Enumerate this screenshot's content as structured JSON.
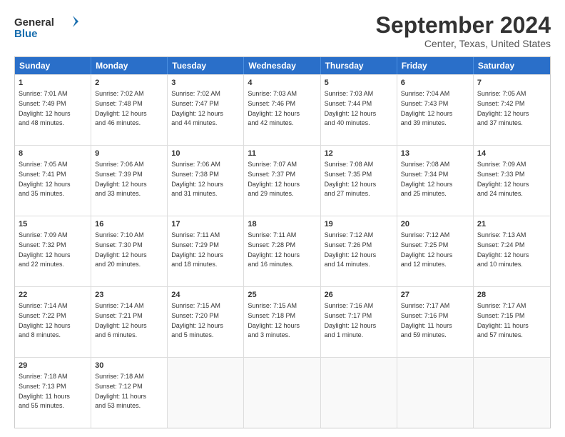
{
  "logo": {
    "line1": "General",
    "line2": "Blue"
  },
  "title": "September 2024",
  "subtitle": "Center, Texas, United States",
  "headers": [
    "Sunday",
    "Monday",
    "Tuesday",
    "Wednesday",
    "Thursday",
    "Friday",
    "Saturday"
  ],
  "rows": [
    [
      {
        "day": "",
        "empty": true
      },
      {
        "day": "",
        "empty": true
      },
      {
        "day": "",
        "empty": true
      },
      {
        "day": "",
        "empty": true
      },
      {
        "day": "",
        "empty": true
      },
      {
        "day": "",
        "empty": true
      },
      {
        "day": "",
        "empty": true
      }
    ],
    [
      {
        "day": "1",
        "text": "Sunrise: 7:01 AM\nSunset: 7:49 PM\nDaylight: 12 hours\nand 48 minutes."
      },
      {
        "day": "2",
        "text": "Sunrise: 7:02 AM\nSunset: 7:48 PM\nDaylight: 12 hours\nand 46 minutes."
      },
      {
        "day": "3",
        "text": "Sunrise: 7:02 AM\nSunset: 7:47 PM\nDaylight: 12 hours\nand 44 minutes."
      },
      {
        "day": "4",
        "text": "Sunrise: 7:03 AM\nSunset: 7:46 PM\nDaylight: 12 hours\nand 42 minutes."
      },
      {
        "day": "5",
        "text": "Sunrise: 7:03 AM\nSunset: 7:44 PM\nDaylight: 12 hours\nand 40 minutes."
      },
      {
        "day": "6",
        "text": "Sunrise: 7:04 AM\nSunset: 7:43 PM\nDaylight: 12 hours\nand 39 minutes."
      },
      {
        "day": "7",
        "text": "Sunrise: 7:05 AM\nSunset: 7:42 PM\nDaylight: 12 hours\nand 37 minutes."
      }
    ],
    [
      {
        "day": "8",
        "text": "Sunrise: 7:05 AM\nSunset: 7:41 PM\nDaylight: 12 hours\nand 35 minutes."
      },
      {
        "day": "9",
        "text": "Sunrise: 7:06 AM\nSunset: 7:39 PM\nDaylight: 12 hours\nand 33 minutes."
      },
      {
        "day": "10",
        "text": "Sunrise: 7:06 AM\nSunset: 7:38 PM\nDaylight: 12 hours\nand 31 minutes."
      },
      {
        "day": "11",
        "text": "Sunrise: 7:07 AM\nSunset: 7:37 PM\nDaylight: 12 hours\nand 29 minutes."
      },
      {
        "day": "12",
        "text": "Sunrise: 7:08 AM\nSunset: 7:35 PM\nDaylight: 12 hours\nand 27 minutes."
      },
      {
        "day": "13",
        "text": "Sunrise: 7:08 AM\nSunset: 7:34 PM\nDaylight: 12 hours\nand 25 minutes."
      },
      {
        "day": "14",
        "text": "Sunrise: 7:09 AM\nSunset: 7:33 PM\nDaylight: 12 hours\nand 24 minutes."
      }
    ],
    [
      {
        "day": "15",
        "text": "Sunrise: 7:09 AM\nSunset: 7:32 PM\nDaylight: 12 hours\nand 22 minutes."
      },
      {
        "day": "16",
        "text": "Sunrise: 7:10 AM\nSunset: 7:30 PM\nDaylight: 12 hours\nand 20 minutes."
      },
      {
        "day": "17",
        "text": "Sunrise: 7:11 AM\nSunset: 7:29 PM\nDaylight: 12 hours\nand 18 minutes."
      },
      {
        "day": "18",
        "text": "Sunrise: 7:11 AM\nSunset: 7:28 PM\nDaylight: 12 hours\nand 16 minutes."
      },
      {
        "day": "19",
        "text": "Sunrise: 7:12 AM\nSunset: 7:26 PM\nDaylight: 12 hours\nand 14 minutes."
      },
      {
        "day": "20",
        "text": "Sunrise: 7:12 AM\nSunset: 7:25 PM\nDaylight: 12 hours\nand 12 minutes."
      },
      {
        "day": "21",
        "text": "Sunrise: 7:13 AM\nSunset: 7:24 PM\nDaylight: 12 hours\nand 10 minutes."
      }
    ],
    [
      {
        "day": "22",
        "text": "Sunrise: 7:14 AM\nSunset: 7:22 PM\nDaylight: 12 hours\nand 8 minutes."
      },
      {
        "day": "23",
        "text": "Sunrise: 7:14 AM\nSunset: 7:21 PM\nDaylight: 12 hours\nand 6 minutes."
      },
      {
        "day": "24",
        "text": "Sunrise: 7:15 AM\nSunset: 7:20 PM\nDaylight: 12 hours\nand 5 minutes."
      },
      {
        "day": "25",
        "text": "Sunrise: 7:15 AM\nSunset: 7:18 PM\nDaylight: 12 hours\nand 3 minutes."
      },
      {
        "day": "26",
        "text": "Sunrise: 7:16 AM\nSunset: 7:17 PM\nDaylight: 12 hours\nand 1 minute."
      },
      {
        "day": "27",
        "text": "Sunrise: 7:17 AM\nSunset: 7:16 PM\nDaylight: 11 hours\nand 59 minutes."
      },
      {
        "day": "28",
        "text": "Sunrise: 7:17 AM\nSunset: 7:15 PM\nDaylight: 11 hours\nand 57 minutes."
      }
    ],
    [
      {
        "day": "29",
        "text": "Sunrise: 7:18 AM\nSunset: 7:13 PM\nDaylight: 11 hours\nand 55 minutes."
      },
      {
        "day": "30",
        "text": "Sunrise: 7:18 AM\nSunset: 7:12 PM\nDaylight: 11 hours\nand 53 minutes."
      },
      {
        "day": "",
        "empty": true
      },
      {
        "day": "",
        "empty": true
      },
      {
        "day": "",
        "empty": true
      },
      {
        "day": "",
        "empty": true
      },
      {
        "day": "",
        "empty": true
      }
    ]
  ]
}
